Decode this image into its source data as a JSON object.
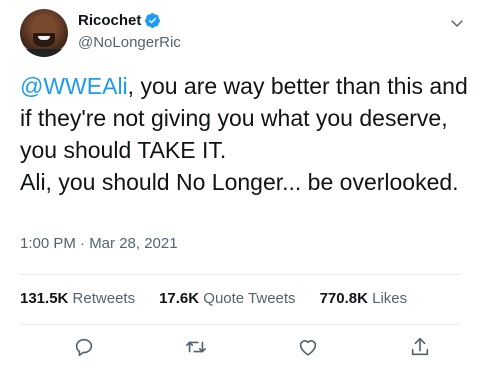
{
  "author": {
    "display_name": "Ricochet",
    "handle": "@NoLongerRic",
    "verified": true
  },
  "tweet": {
    "mention": "@WWEAli",
    "text_after_mention": ", you are way better than this and if they're not giving you what you deserve, you should TAKE IT.\nAli, you should No Longer... be overlooked.",
    "timestamp": "1:00 PM · Mar 28, 2021"
  },
  "stats": {
    "retweets": {
      "count": "131.5K",
      "label": "Retweets"
    },
    "quote_tweets": {
      "count": "17.6K",
      "label": "Quote Tweets"
    },
    "likes": {
      "count": "770.8K",
      "label": "Likes"
    }
  },
  "icons": {
    "verified": "verified-badge-icon",
    "caret": "chevron-down-icon",
    "reply": "reply-icon",
    "retweet": "retweet-icon",
    "like": "heart-icon",
    "share": "share-icon"
  },
  "colors": {
    "accent": "#1d9bf0",
    "text": "#0f1419",
    "secondary": "#536471",
    "divider": "#e6ecf0"
  }
}
